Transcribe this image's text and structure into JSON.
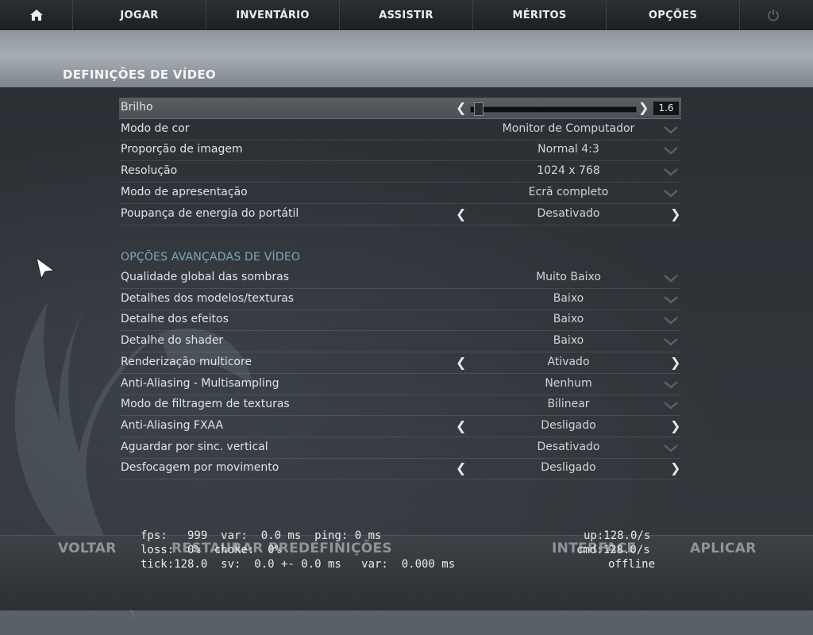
{
  "nav": {
    "items": [
      "JOGAR",
      "INVENTÁRIO",
      "ASSISTIR",
      "MÉRITOS",
      "OPÇÕES"
    ]
  },
  "page_title": "DEFINIÇÕES DE VÍDEO",
  "brightness": {
    "label": "Brilho",
    "value": "1.6",
    "level": 0.02
  },
  "basic_rows": [
    {
      "label": "Modo de cor",
      "value": "Monitor de Computador",
      "control": "dropdown"
    },
    {
      "label": "Proporção de imagem",
      "value": "Normal 4:3",
      "control": "dropdown"
    },
    {
      "label": "Resolução",
      "value": "1024 x 768",
      "control": "dropdown"
    },
    {
      "label": "Modo de apresentação",
      "value": "Ecrã completo",
      "control": "dropdown"
    },
    {
      "label": "Poupança de energia do portátil",
      "value": "Desativado",
      "control": "arrows"
    }
  ],
  "advanced_title": "OPÇÕES AVANÇADAS DE VÍDEO",
  "advanced_rows": [
    {
      "label": "Qualidade global das sombras",
      "value": "Muito Baixo",
      "control": "dropdown"
    },
    {
      "label": "Detalhes dos modelos/texturas",
      "value": "Baixo",
      "control": "dropdown"
    },
    {
      "label": "Detalhe dos efeitos",
      "value": "Baixo",
      "control": "dropdown"
    },
    {
      "label": "Detalhe do shader",
      "value": "Baixo",
      "control": "dropdown"
    },
    {
      "label": "Renderização multicore",
      "value": "Ativado",
      "control": "arrows"
    },
    {
      "label": "Anti-Aliasing - Multisampling",
      "value": "Nenhum",
      "control": "dropdown"
    },
    {
      "label": "Modo de filtragem de texturas",
      "value": "Bilinear",
      "control": "dropdown"
    },
    {
      "label": "Anti-Aliasing FXAA",
      "value": "Desligado",
      "control": "arrows"
    },
    {
      "label": "Aguardar por sinc. vertical",
      "value": "Desativado",
      "control": "dropdown"
    },
    {
      "label": "Desfocagem por movimento",
      "value": "Desligado",
      "control": "arrows"
    }
  ],
  "bottom": {
    "back": "VOLTAR",
    "restore": "RESTAURAR PREDEFINIÇÕES",
    "interface": "INTERFACE",
    "apply": "APLICAR"
  },
  "netgraph": {
    "line1": "fps:   999  var:  0.0 ms  ping: 0 ms",
    "line2": "loss:  0%  choke:  0%",
    "line3": "tick:128.0  sv:  0.0 +- 0.0 ms   var:  0.000 ms",
    "right1": "up:128.0/s",
    "right2": "cmd:128.0/s",
    "right3": "offline"
  }
}
